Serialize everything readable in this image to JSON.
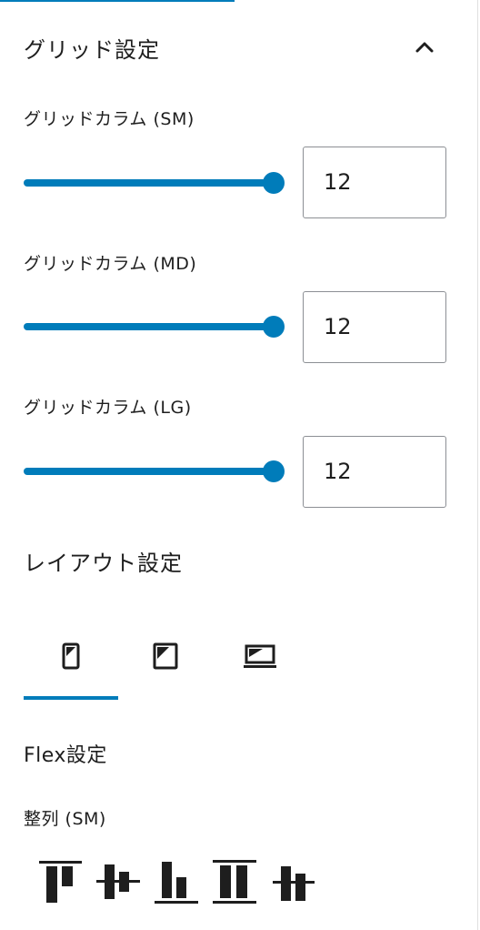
{
  "grid_settings": {
    "title": "グリッド設定",
    "collapse_icon": "chevron-up-icon",
    "controls": [
      {
        "label": "グリッドカラム (SM)",
        "value": "12",
        "slider_fraction": 1.0
      },
      {
        "label": "グリッドカラム (MD)",
        "value": "12",
        "slider_fraction": 1.0
      },
      {
        "label": "グリッドカラム (LG)",
        "value": "12",
        "slider_fraction": 1.0
      }
    ]
  },
  "layout_settings": {
    "title": "レイアウト設定",
    "device_tabs": [
      {
        "name": "mobile",
        "icon": "mobile-icon",
        "selected": true
      },
      {
        "name": "tablet",
        "icon": "tablet-icon",
        "selected": false
      },
      {
        "name": "desktop",
        "icon": "laptop-icon",
        "selected": false
      }
    ]
  },
  "flex_settings": {
    "title": "Flex設定",
    "align_label": "整列 (SM)",
    "align_options": [
      {
        "name": "align-top",
        "icon": "align-top-icon"
      },
      {
        "name": "align-center",
        "icon": "align-center-icon"
      },
      {
        "name": "align-bottom",
        "icon": "align-bottom-icon"
      },
      {
        "name": "stretch",
        "icon": "stretch-icon"
      },
      {
        "name": "baseline",
        "icon": "baseline-icon"
      }
    ]
  },
  "colors": {
    "accent": "#007cba",
    "text": "#1e1e1e",
    "input_border": "#8c8f94"
  }
}
